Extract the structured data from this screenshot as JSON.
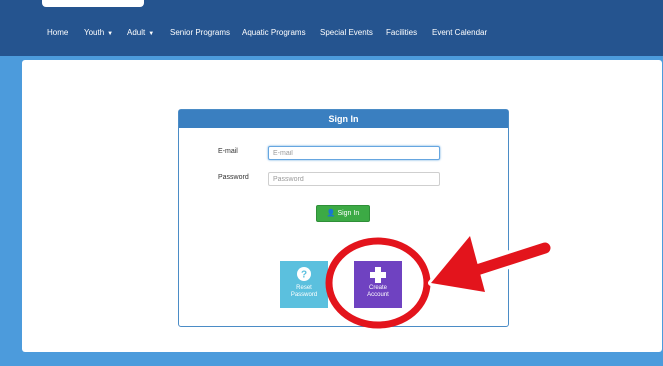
{
  "nav": {
    "items": [
      {
        "label": "Home",
        "dropdown": false
      },
      {
        "label": "Youth",
        "dropdown": true
      },
      {
        "label": "Adult",
        "dropdown": true
      },
      {
        "label": "Senior Programs",
        "dropdown": false
      },
      {
        "label": "Aquatic Programs",
        "dropdown": false
      },
      {
        "label": "Special Events",
        "dropdown": false
      },
      {
        "label": "Facilities",
        "dropdown": false
      },
      {
        "label": "Event Calendar",
        "dropdown": false
      }
    ]
  },
  "signin": {
    "title": "Sign In",
    "email_label": "E-mail",
    "email_placeholder": "E-mail",
    "password_label": "Password",
    "password_placeholder": "Password",
    "button_label": "Sign In"
  },
  "tiles": {
    "reset": {
      "line1": "Reset",
      "line2": "Password",
      "icon": "question-circle-icon"
    },
    "create": {
      "line1": "Create",
      "line2": "Account",
      "icon": "plus-icon"
    }
  },
  "colors": {
    "header": "#25548f",
    "band": "#4c9bdc",
    "panel_header": "#3a7fc0",
    "signin_button": "#3caa45",
    "reset_tile": "#5bc0de",
    "create_tile": "#6f42c1",
    "annotation": "#e3141c"
  }
}
